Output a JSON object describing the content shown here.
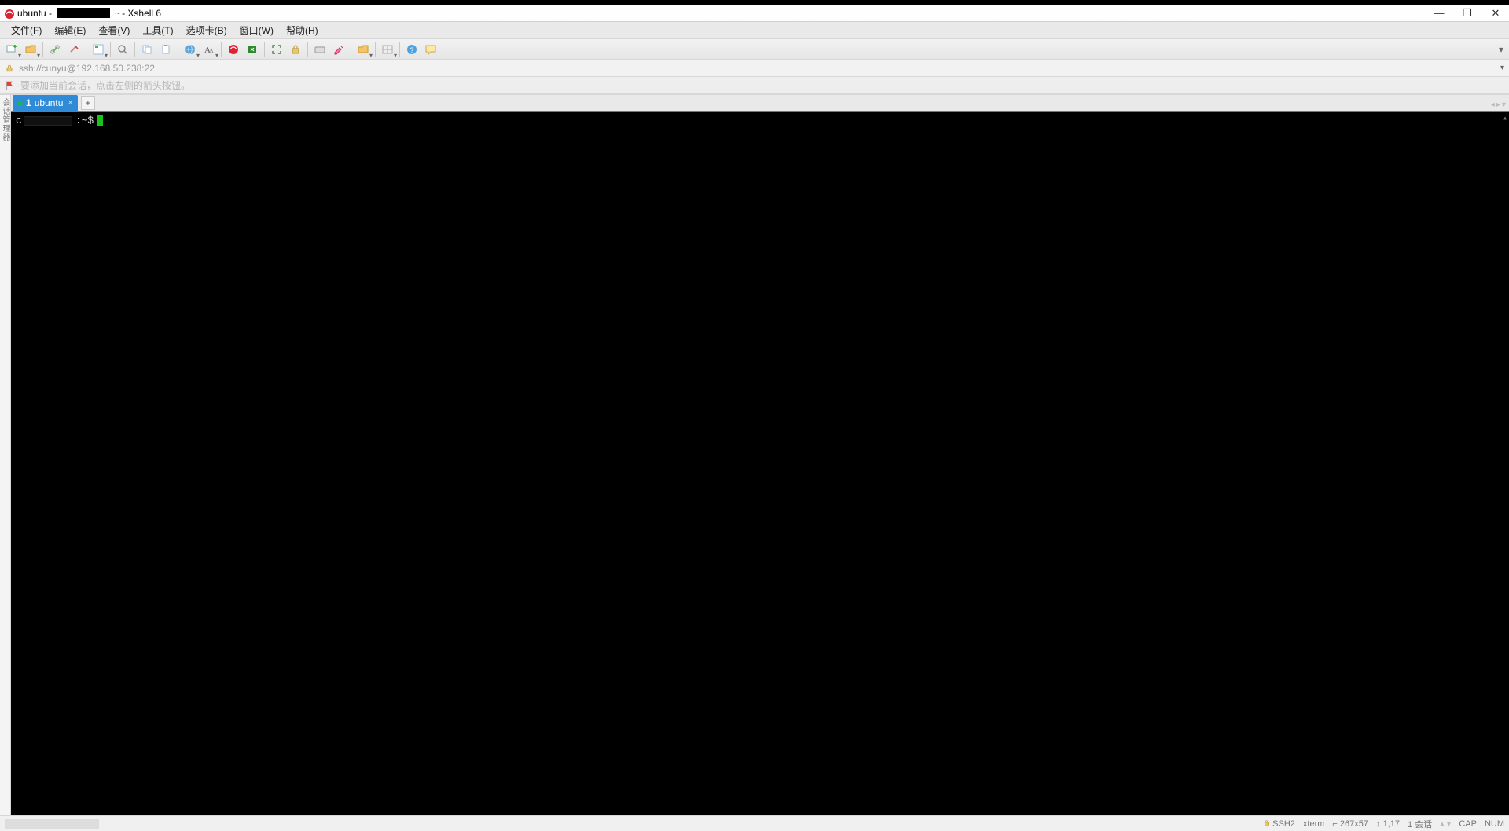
{
  "window": {
    "title_prefix": "ubuntu -",
    "title_mid": "~",
    "title_suffix": "- Xshell 6"
  },
  "menu": {
    "file": "文件(F)",
    "edit": "编辑(E)",
    "view": "查看(V)",
    "tools": "工具(T)",
    "tabs": "选项卡(B)",
    "window": "窗口(W)",
    "help": "帮助(H)"
  },
  "addr": {
    "text": "ssh://cunyu@192.168.50.238:22"
  },
  "hint": {
    "text": "要添加当前会话，点击左侧的箭头按钮。"
  },
  "gutter": {
    "label": "会话管理器"
  },
  "tabs": {
    "active": {
      "index": "1",
      "label": "ubuntu"
    },
    "add": "+"
  },
  "terminal": {
    "prompt_left": "c",
    "prompt_right": ":~$"
  },
  "status": {
    "ssh": "SSH2",
    "term": "xterm",
    "size_icon": "⌐",
    "size": "267x57",
    "pos_icon": "↕",
    "pos": "1,17",
    "sessions": "1 会话",
    "cap": "CAP",
    "num": "NUM"
  }
}
